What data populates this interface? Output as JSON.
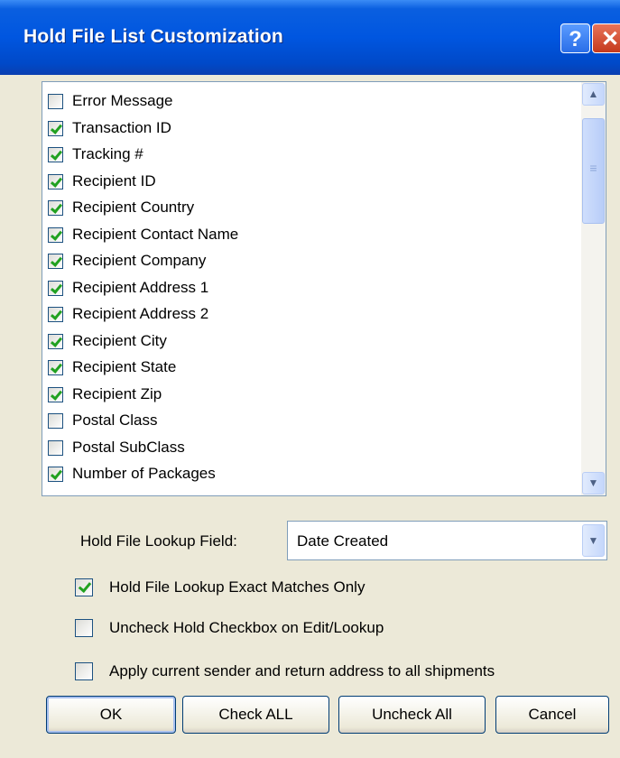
{
  "window": {
    "title": "Hold File List Customization",
    "help_label": "?",
    "close_label": "✕"
  },
  "columns": [
    {
      "label": "Error Message",
      "checked": false
    },
    {
      "label": "Transaction ID",
      "checked": true
    },
    {
      "label": "Tracking #",
      "checked": true
    },
    {
      "label": "Recipient ID",
      "checked": true
    },
    {
      "label": "Recipient Country",
      "checked": true
    },
    {
      "label": "Recipient Contact Name",
      "checked": true
    },
    {
      "label": "Recipient Company",
      "checked": true
    },
    {
      "label": "Recipient Address 1",
      "checked": true
    },
    {
      "label": "Recipient Address 2",
      "checked": true
    },
    {
      "label": "Recipient City",
      "checked": true
    },
    {
      "label": "Recipient State",
      "checked": true
    },
    {
      "label": "Recipient Zip",
      "checked": true
    },
    {
      "label": "Postal Class",
      "checked": false
    },
    {
      "label": "Postal SubClass",
      "checked": false
    },
    {
      "label": "Number of Packages",
      "checked": true
    }
  ],
  "lookup": {
    "label": "Hold File Lookup Field:",
    "value": "Date Created"
  },
  "options": [
    {
      "label": "Hold File Lookup Exact Matches Only",
      "checked": true
    },
    {
      "label": "Uncheck Hold Checkbox on Edit/Lookup",
      "checked": false
    },
    {
      "label": "Apply current sender and return address to all shipments",
      "checked": false
    }
  ],
  "buttons": {
    "ok": "OK",
    "check_all": "Check ALL",
    "uncheck_all": "Uncheck All",
    "cancel": "Cancel"
  },
  "icons": {
    "scroll_up": "chevron-up-icon",
    "scroll_down": "chevron-down-icon",
    "dropdown": "chevron-down-icon"
  }
}
